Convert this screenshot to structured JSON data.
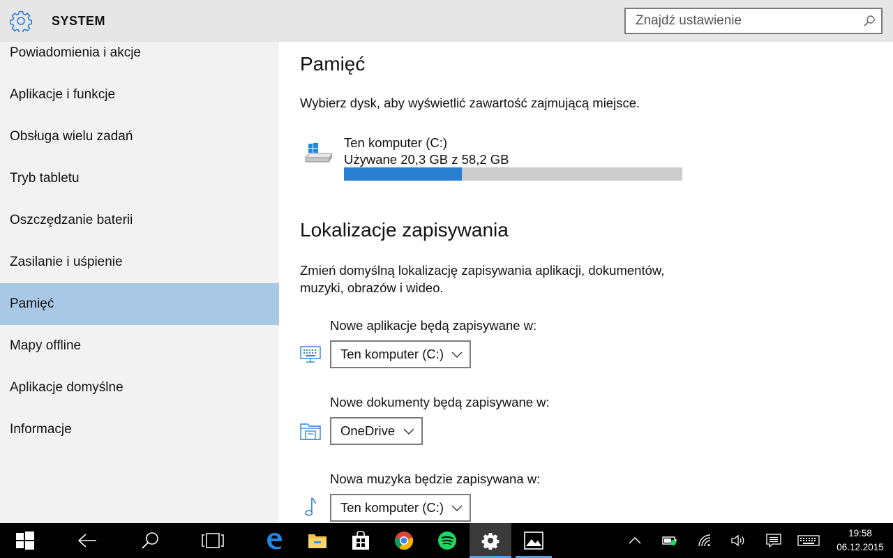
{
  "header": {
    "title": "SYSTEM",
    "search_placeholder": "Znajdź ustawienie"
  },
  "sidebar": {
    "items": [
      {
        "label": "Powiadomienia i akcje"
      },
      {
        "label": "Aplikacje i funkcje"
      },
      {
        "label": "Obsługa wielu zadań"
      },
      {
        "label": "Tryb tabletu"
      },
      {
        "label": "Oszczędzanie baterii"
      },
      {
        "label": "Zasilanie i uśpienie"
      },
      {
        "label": "Pamięć"
      },
      {
        "label": "Mapy offline"
      },
      {
        "label": "Aplikacje domyślne"
      },
      {
        "label": "Informacje"
      }
    ],
    "selected": "Pamięć"
  },
  "main": {
    "storage_heading": "Pamięć",
    "storage_desc": "Wybierz dysk, aby wyświetlić zawartość zajmującą miejsce.",
    "drive": {
      "name": "Ten komputer (C:)",
      "usage": "Używane 20,3 GB z 58,2 GB",
      "used_fraction": 0.349
    },
    "save_heading": "Lokalizacje zapisywania",
    "save_desc_line1": "Zmień domyślną lokalizację zapisywania aplikacji, dokumentów,",
    "save_desc_line2": "muzyki, obrazów i wideo.",
    "locations": [
      {
        "label": "Nowe aplikacje będą zapisywane w:",
        "value": "Ten komputer (C:)",
        "icon": "monitor-keyboard-icon"
      },
      {
        "label": "Nowe dokumenty będą zapisywane w:",
        "value": "OneDrive",
        "icon": "documents-folder-icon"
      },
      {
        "label": "Nowa muzyka będzie zapisywana w:",
        "value": "Ten komputer (C:)",
        "icon": "music-note-icon"
      }
    ]
  },
  "taskbar": {
    "time": "19:58",
    "date": "06.12.2015"
  },
  "colors": {
    "accent": "#2b7fd1",
    "selected_nav": "#a8c8e6",
    "sidebar_bg": "#f2f2f2",
    "header_bg": "#e6e6e6",
    "bar_empty": "#cccccc"
  }
}
